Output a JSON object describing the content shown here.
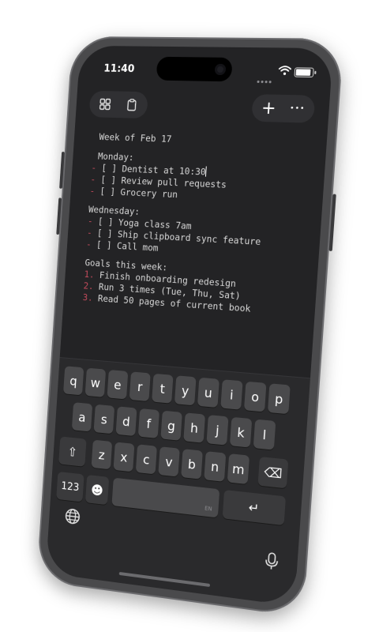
{
  "status_bar": {
    "time": "11:40"
  },
  "toolbar": {
    "left_buttons": [
      "grid-icon",
      "clipboard-icon"
    ],
    "new_label": "+",
    "more_label": "•••"
  },
  "editor": {
    "lines": [
      {
        "kind": "text",
        "text": "Week of Feb 17"
      },
      {
        "kind": "text",
        "text": "Monday:"
      },
      {
        "kind": "todo",
        "prefix": "-",
        "text": "[ ] Dentist at 10:30"
      },
      {
        "kind": "todo",
        "prefix": "-",
        "text": "[ ] Review pull requests"
      },
      {
        "kind": "todo",
        "prefix": "-",
        "text": "[ ] Grocery run"
      },
      {
        "kind": "text",
        "text": "Wednesday:"
      },
      {
        "kind": "todo",
        "prefix": "-",
        "text": "[ ] Yoga class 7am"
      },
      {
        "kind": "todo",
        "prefix": "-",
        "text": "[ ] Ship clipboard sync feature"
      },
      {
        "kind": "todo",
        "prefix": "-",
        "text": "[ ] Call mom"
      },
      {
        "kind": "text",
        "text": "Goals this week:"
      },
      {
        "kind": "numbered",
        "prefix": "1.",
        "text": "Finish onboarding redesign"
      },
      {
        "kind": "numbered",
        "prefix": "2.",
        "text": "Run 3 times (Tue, Thu, Sat)"
      },
      {
        "kind": "numbered",
        "prefix": "3.",
        "text": "Read 50 pages of current book"
      }
    ]
  },
  "keyboard": {
    "row1": [
      "q",
      "w",
      "e",
      "r",
      "t",
      "y",
      "u",
      "i",
      "o",
      "p"
    ],
    "row2": [
      "a",
      "s",
      "d",
      "f",
      "g",
      "h",
      "j",
      "k",
      "l"
    ],
    "row3": [
      "z",
      "x",
      "c",
      "v",
      "b",
      "n",
      "m"
    ],
    "numbers_label": "123",
    "emoji_label": "☻",
    "shift_label": "⇧",
    "delete_label": "⌫",
    "return_label": "↵",
    "space_hint": "EN"
  },
  "colors": {
    "accent": "#c24a5b",
    "screen_bg": "#232325",
    "keyboard_bg": "#2a2a2c",
    "key_bg": "#4a4a4c"
  }
}
